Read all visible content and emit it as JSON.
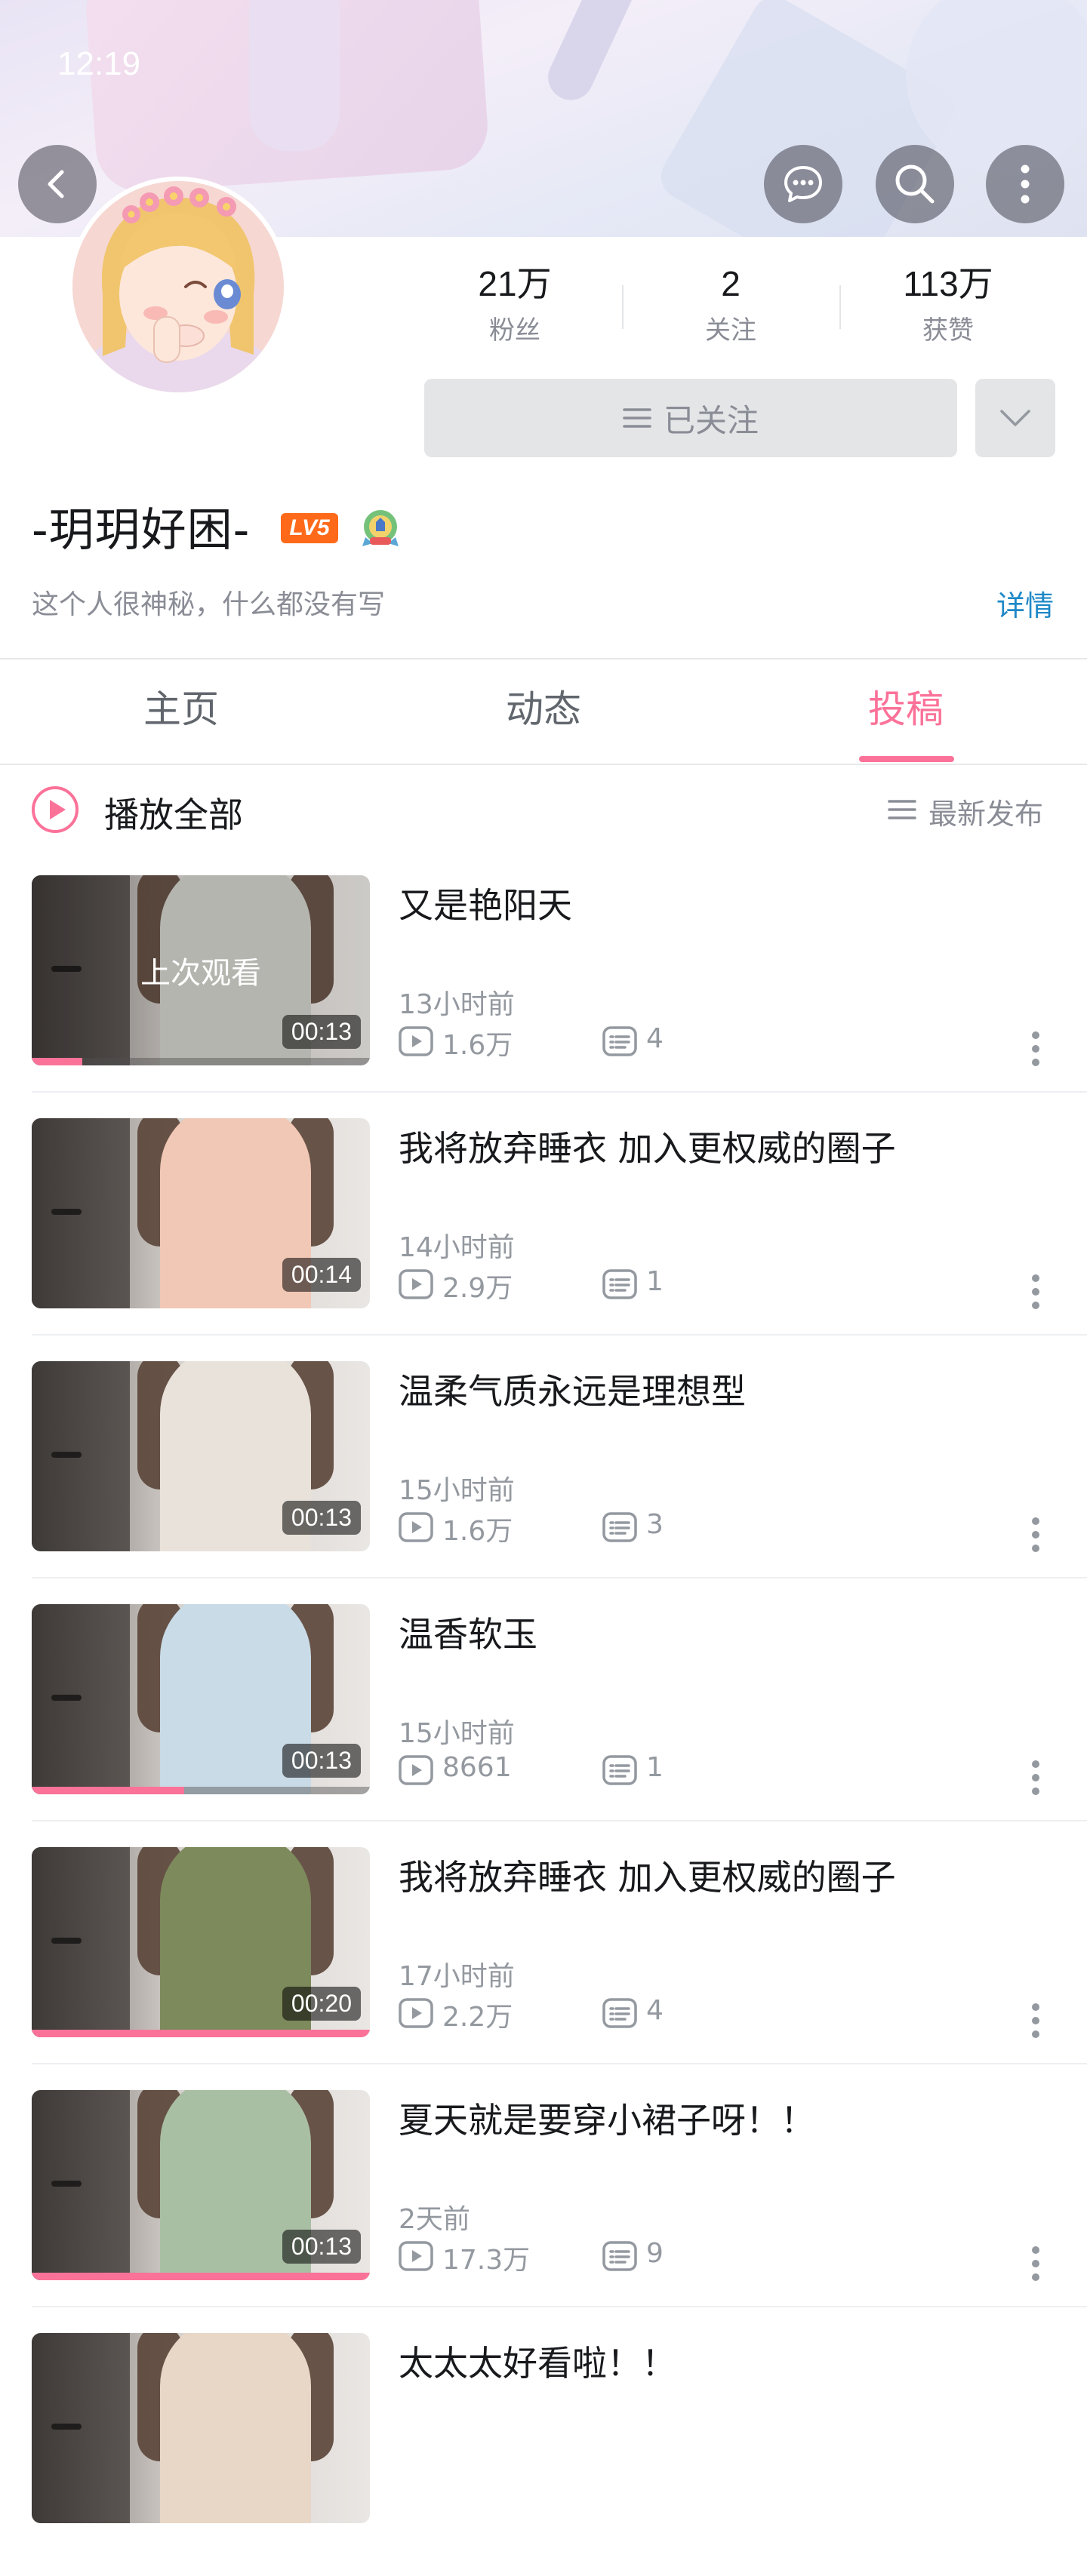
{
  "status_bar": {
    "time": "12:19"
  },
  "profile": {
    "username": "-玥玥好困-",
    "level": "LV5",
    "bio": "这个人很神秘，什么都没有写",
    "detail_link": "详情",
    "stats": [
      {
        "value": "21万",
        "label": "粉丝"
      },
      {
        "value": "2",
        "label": "关注"
      },
      {
        "value": "113万",
        "label": "获赞"
      }
    ],
    "follow_button": "已关注"
  },
  "tabs": [
    {
      "label": "主页",
      "active": false
    },
    {
      "label": "动态",
      "active": false
    },
    {
      "label": "投稿",
      "active": true
    }
  ],
  "toolbar": {
    "play_all": "播放全部",
    "sort": "最新发布"
  },
  "accent_color": "#fb7299",
  "videos": [
    {
      "title": "又是艳阳天",
      "time": "13小时前",
      "views": "1.6万",
      "comments": "4",
      "duration": "00:13",
      "watched_label": "上次观看",
      "progress": 0.15,
      "dress_color": "#cfcfc8"
    },
    {
      "title": "我将放弃睡衣 加入更权威的圈子",
      "time": "14小时前",
      "views": "2.9万",
      "comments": "1",
      "duration": "00:14",
      "watched_label": "",
      "progress": 0,
      "dress_color": "#f1c8b5"
    },
    {
      "title": "温柔气质永远是理想型",
      "time": "15小时前",
      "views": "1.6万",
      "comments": "3",
      "duration": "00:13",
      "watched_label": "",
      "progress": 0,
      "dress_color": "#e8e2da"
    },
    {
      "title": "温香软玉",
      "time": "15小时前",
      "views": "8661",
      "comments": "1",
      "duration": "00:13",
      "watched_label": "",
      "progress": 0.45,
      "dress_color": "#c9dbe6"
    },
    {
      "title": "我将放弃睡衣 加入更权威的圈子",
      "time": "17小时前",
      "views": "2.2万",
      "comments": "4",
      "duration": "00:20",
      "watched_label": "",
      "progress": 1.0,
      "dress_color": "#7d8a5c"
    },
    {
      "title": "夏天就是要穿小裙子呀！！",
      "time": "2天前",
      "views": "17.3万",
      "comments": "9",
      "duration": "00:13",
      "watched_label": "",
      "progress": 1.0,
      "dress_color": "#a9bfa4"
    },
    {
      "title": "太太太好看啦！！",
      "time": "",
      "views": "",
      "comments": "",
      "duration": "",
      "watched_label": "",
      "progress": 0,
      "dress_color": "#e8d6c6"
    }
  ]
}
